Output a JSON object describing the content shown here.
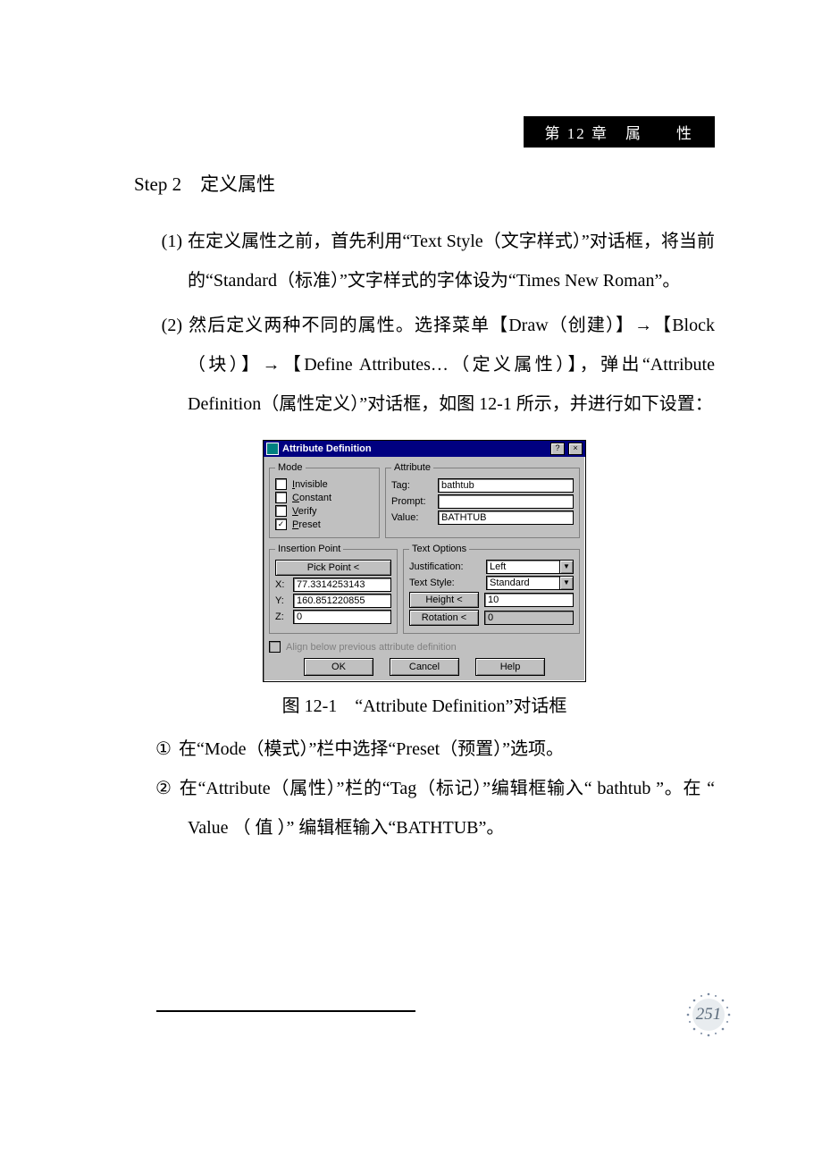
{
  "chapter_banner": "第 12 章　属　　性",
  "step_heading_prefix": "Step 2",
  "step_heading_title": "　定义属性",
  "items": [
    {
      "num": "(1)",
      "text": "在定义属性之前，首先利用“Text Style（文字样式）”对话框，将当前的“Standard（标准）”文字样式的字体设为“Times New Roman”。"
    },
    {
      "num": "(2)",
      "text": "然后定义两种不同的属性。选择菜单【Draw（创建）】→【Block（块）】→【Define Attributes…（定义属性）】，弹出“Attribute Definition（属性定义）”对话框，如图 12-1 所示，并进行如下设置："
    }
  ],
  "dialog": {
    "title": "Attribute Definition",
    "help_btn": "?",
    "close_btn": "×",
    "groups": {
      "mode": "Mode",
      "attribute": "Attribute",
      "insertion": "Insertion Point",
      "textopt": "Text Options"
    },
    "mode": {
      "invisible": "Invisible",
      "constant": "Constant",
      "verify": "Verify",
      "preset": "Preset",
      "preset_checked": "✓"
    },
    "attr": {
      "tag_label": "Tag:",
      "tag_value": "bathtub",
      "prompt_label": "Prompt:",
      "prompt_value": "",
      "value_label": "Value:",
      "value_value": "BATHTUB"
    },
    "insertion": {
      "pick": "Pick Point <",
      "x_label": "X:",
      "x": "77.3314253143",
      "y_label": "Y:",
      "y": "160.851220855",
      "z_label": "Z:",
      "z": "0"
    },
    "textopt": {
      "just_label": "Justification:",
      "just_value": "Left",
      "style_label": "Text Style:",
      "style_value": "Standard",
      "height_btn": "Height <",
      "height_value": "10",
      "rot_btn": "Rotation <",
      "rot_value": "0"
    },
    "align_below": "Align below previous attribute definition",
    "buttons": {
      "ok": "OK",
      "cancel": "Cancel",
      "help": "Help"
    }
  },
  "caption": "图 12-1　“Attribute Definition”对话框",
  "subitems": [
    {
      "num": "①",
      "text": "在“Mode（模式）”栏中选择“Preset（预置）”选项。"
    },
    {
      "num": "②",
      "text": "在“Attribute（属性）”栏的“Tag（标记）”编辑框输入“ bathtub ”。在 “ Value （ 值 ）” 编辑框输入“BATHTUB”。"
    }
  ],
  "page_number": "251"
}
